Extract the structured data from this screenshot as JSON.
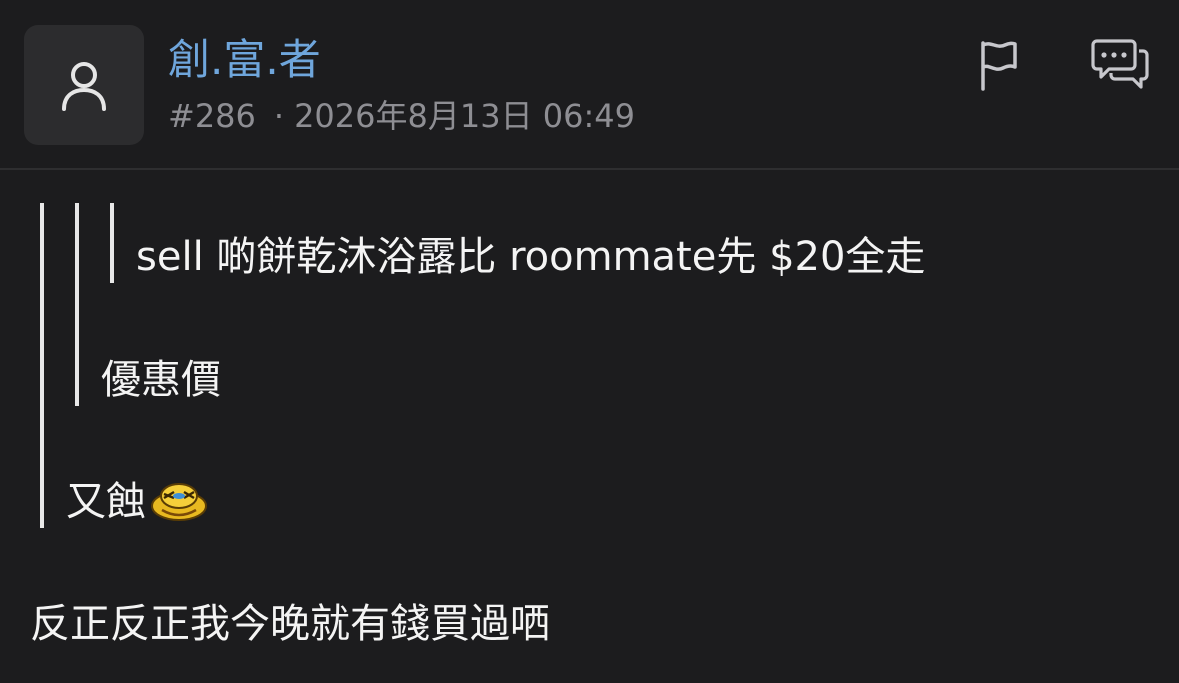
{
  "post": {
    "username": "創.富.者",
    "number": "#286",
    "separator": "·",
    "datetime": "2026年8月13日 06:49"
  },
  "icons": {
    "avatar": "user-avatar-icon",
    "report": "flag-icon",
    "reply": "chat-bubbles-icon",
    "emoji": "smiley-emoji-icon"
  },
  "colors": {
    "background": "#1c1c1e",
    "username": "#6fa6dc",
    "meta": "#8e8e93",
    "quote_bar": "#e8e8e8"
  },
  "content": {
    "quote_level3": "sell 啲餅乾沐浴露比 roommate先  $20全走",
    "quote_level2": "優惠價",
    "quote_level1": "又蝕",
    "body": "反正反正我今晚就有錢買過哂"
  }
}
